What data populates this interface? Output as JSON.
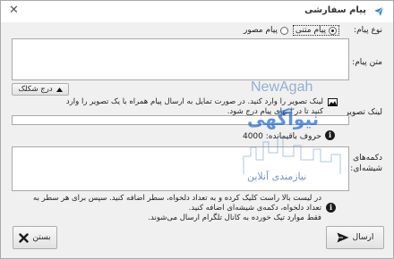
{
  "window": {
    "title": "پیام سفارشی",
    "close_glyph": "✕"
  },
  "message_type": {
    "label": "نوع پیام:",
    "options": [
      {
        "label": "پیام متنی",
        "selected": true
      },
      {
        "label": "پیام مصور",
        "selected": false
      }
    ]
  },
  "message_text": {
    "label": "متن پیام:",
    "value": ""
  },
  "insert_button": {
    "label": "درج شکلک",
    "icon": "caret-up-icon"
  },
  "image_link": {
    "label": "لینک تصویر",
    "hint": "لینک تصویر را وارد کنید. در صورت تمایل به ارسال پیام همراه با یک تصویر را وارد کنید تا در انتهای پیام درج شود.",
    "value": ""
  },
  "char_limit": {
    "text": "حروف باقیمانده: 4000"
  },
  "glass_buttons": {
    "label": "دکمه‌های شیشه‌ای:",
    "value": "",
    "hint_line1": "در لیست بالا راست کلیک کرده و به تعداد دلخواه، سطر اضافه کنید. سپس برای هر سطر به",
    "hint_line2": "تعداد دلخواه، دکمه‌ی شیشه‌ای اضافه کنید.",
    "hint_line3": "فقط موارد تیک خورده به کانال تلگرام ارسال می‌شوند."
  },
  "send_button": {
    "label": "ارسال",
    "icon": "send-icon"
  },
  "close_button": {
    "label": "بستن",
    "icon": "close-icon"
  },
  "watermark": {
    "brand_latin": "NewAgah",
    "brand_fa": "نیوآگهی",
    "tagline": "نیازمندی آنلاین"
  },
  "colors": {
    "accent_icon": "#3a86c8",
    "info_icon": "#1b1b1b",
    "close_x": "#1a1a1a"
  }
}
